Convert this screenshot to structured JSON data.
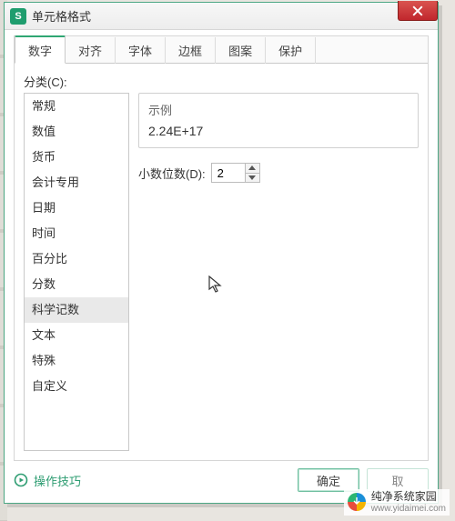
{
  "window": {
    "title": "单元格格式"
  },
  "tabs": [
    {
      "label": "数字",
      "active": true
    },
    {
      "label": "对齐",
      "active": false
    },
    {
      "label": "字体",
      "active": false
    },
    {
      "label": "边框",
      "active": false
    },
    {
      "label": "图案",
      "active": false
    },
    {
      "label": "保护",
      "active": false
    }
  ],
  "category_label": "分类(C):",
  "categories": [
    "常规",
    "数值",
    "货币",
    "会计专用",
    "日期",
    "时间",
    "百分比",
    "分数",
    "科学记数",
    "文本",
    "特殊",
    "自定义"
  ],
  "selected_category_index": 8,
  "sample": {
    "title": "示例",
    "value": "2.24E+17"
  },
  "decimals": {
    "label": "小数位数(D):",
    "value": "2"
  },
  "footer": {
    "tips": "操作技巧",
    "ok": "确定",
    "cancel": "取"
  },
  "watermark": {
    "name": "纯净系统家园",
    "url": "www.yidaimei.com"
  }
}
